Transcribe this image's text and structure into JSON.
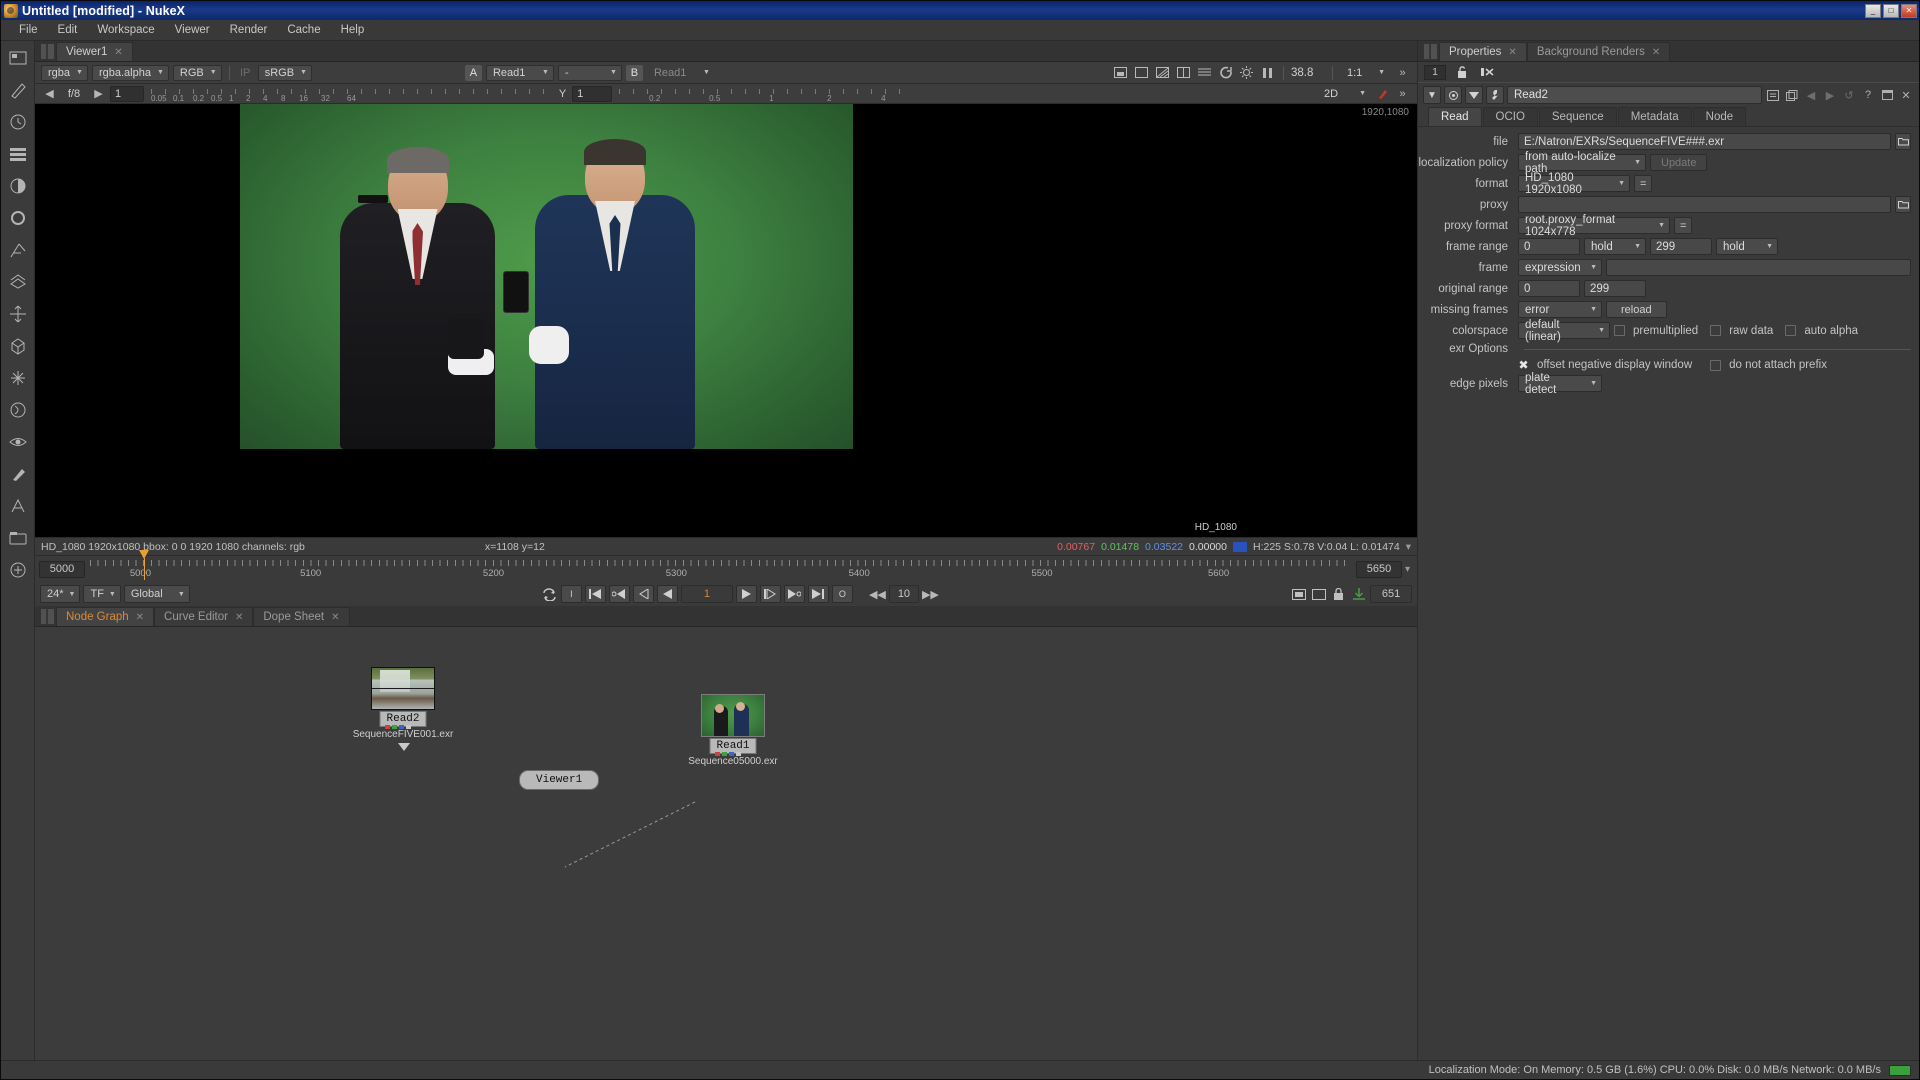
{
  "window": {
    "title": "Untitled [modified] - NukeX",
    "app_icon": "nuke-logo-icon",
    "buttons": {
      "minimize": "_",
      "maximize": "□",
      "close": "✕"
    }
  },
  "menubar": {
    "items": [
      "File",
      "Edit",
      "Workspace",
      "Viewer",
      "Render",
      "Cache",
      "Help"
    ]
  },
  "toolrail": {
    "items": [
      {
        "name": "image-node-icon"
      },
      {
        "name": "draw-node-icon"
      },
      {
        "name": "time-node-icon"
      },
      {
        "name": "channel-node-icon"
      },
      {
        "name": "color-node-icon"
      },
      {
        "name": "filter-node-icon"
      },
      {
        "name": "keyer-node-icon"
      },
      {
        "name": "merge-node-icon"
      },
      {
        "name": "transform-node-icon"
      },
      {
        "name": "3d-node-icon"
      },
      {
        "name": "particles-node-icon"
      },
      {
        "name": "deep-node-icon"
      },
      {
        "name": "views-node-icon"
      },
      {
        "name": "metadata-node-icon"
      },
      {
        "name": "toolsets-node-icon"
      },
      {
        "name": "other-node-icon"
      },
      {
        "name": "plugins-node-icon"
      }
    ]
  },
  "viewer": {
    "tab_label": "Viewer1",
    "tab_close": "✕",
    "toolbar": {
      "channels": "rgba",
      "layer": "rgba.alpha",
      "display": "RGB",
      "ip_label": "IP",
      "viewer_process": "sRGB",
      "a_label": "A",
      "a_input": "Read1",
      "mix_value": "-",
      "b_label": "B",
      "b_input": "Read1",
      "zoom_value": "38.8",
      "ratio": "1:1",
      "icons": [
        "roi-icon",
        "format-icon",
        "wipe-icon",
        "compare-icon",
        "proxy-icon",
        "refresh-icon",
        "gear-icon",
        "pause-icon"
      ]
    },
    "toolbar2": {
      "gain_label": "f/8",
      "gain_value": "1",
      "gamma_label": "Y",
      "gamma_value": "1",
      "dim_mode": "2D",
      "ruler_labels": [
        "0.05",
        "0.1",
        "0.2",
        "0.5",
        "1",
        "2",
        "4",
        "8",
        "16",
        "32",
        "64"
      ],
      "ruler_small": [
        "0.2",
        "0.5",
        "1",
        "2",
        "4"
      ]
    },
    "overlay_top_right": "1920,1080",
    "overlay_bottom_right": "HD_1080",
    "status": {
      "format_info": "HD_1080 1920x1080  bbox: 0 0 1920 1080 channels: rgb",
      "coords": "x=1108 y=12",
      "r": "0.00767",
      "g": "0.01478",
      "b": "0.03522",
      "a": "0.00000",
      "hsv": "H:225 S:0.78 V:0.04  L: 0.01474"
    }
  },
  "timeline": {
    "start_frame": "5000",
    "end_frame": "5650",
    "ticks": [
      "5000",
      "5100",
      "5200",
      "5300",
      "5400",
      "5500",
      "5600",
      "5650"
    ],
    "playhead_frame": "5000",
    "transport": {
      "loop_icon": "loop-icon",
      "buttons": [
        "set-in-icon",
        "first-frame-icon",
        "prev-keyframe-icon",
        "prev-frame-icon",
        "play-backward-icon"
      ],
      "current_frame": "1",
      "buttons_right": [
        "play-forward-icon",
        "next-frame-icon",
        "next-keyframe-icon",
        "last-frame-icon",
        "set-out-icon"
      ],
      "back_icon": "skip-back-icon",
      "increment": "10",
      "fwd_icon": "skip-forward-icon",
      "fps": "24*",
      "fps_mode": "TF",
      "sync_mode": "Global",
      "right_icons": [
        "key-icon",
        "lock-icon",
        "sync-icon",
        "download-icon"
      ],
      "right_value": "651"
    }
  },
  "nodegraph": {
    "tabs": [
      {
        "label": "Node Graph",
        "active": true,
        "close": "✕"
      },
      {
        "label": "Curve Editor",
        "active": false,
        "close": "✕"
      },
      {
        "label": "Dope Sheet",
        "active": false,
        "close": "✕"
      }
    ],
    "nodes": [
      {
        "name": "Read2",
        "file": "SequenceFIVE001.exr",
        "thumb": "waterfall"
      },
      {
        "name": "Read1",
        "file": "Sequence05000.exr",
        "thumb": "greenscreen"
      },
      {
        "name": "Viewer1",
        "type": "viewer"
      }
    ]
  },
  "properties": {
    "tabs": [
      {
        "label": "Properties",
        "active": true,
        "close": "✕"
      },
      {
        "label": "Background Renders",
        "active": false,
        "close": "✕"
      }
    ],
    "toolbar": {
      "count": "1",
      "lock_icon": "unlock-icon",
      "clear_icon": "clear-all-icon"
    },
    "node_header": {
      "collapse_icon": "triangle-down-icon",
      "color_icon": "color-swatch-icon",
      "mask_icon": "mask-icon",
      "wrench_icon": "wrench-icon",
      "node_name": "Read2",
      "icons": [
        "script-icon",
        "duplicate-icon",
        "prev-icon",
        "next-icon",
        "revert-icon",
        "help-icon",
        "float-icon",
        "close-icon"
      ]
    },
    "node_tabs": [
      {
        "label": "Read",
        "active": true
      },
      {
        "label": "OCIO",
        "active": false
      },
      {
        "label": "Sequence",
        "active": false
      },
      {
        "label": "Metadata",
        "active": false
      },
      {
        "label": "Node",
        "active": false
      }
    ],
    "fields": {
      "file": {
        "label": "file",
        "value": "E:/Natron/EXRs/SequenceFIVE###.exr",
        "browse_icon": "folder-icon"
      },
      "localization_policy": {
        "label": "localization policy",
        "value": "from auto-localize path",
        "button": "Update"
      },
      "format": {
        "label": "format",
        "value": "HD_1080 1920x1080",
        "eq_button": "="
      },
      "proxy": {
        "label": "proxy",
        "value": "",
        "browse_icon": "folder-icon"
      },
      "proxy_format": {
        "label": "proxy format",
        "value": "root.proxy_format 1024x778",
        "eq_button": "="
      },
      "frame_range": {
        "label": "frame range",
        "start": "0",
        "start_mode": "hold",
        "end": "299",
        "end_mode": "hold"
      },
      "frame": {
        "label": "frame",
        "mode": "expression",
        "value": ""
      },
      "original_range": {
        "label": "original range",
        "start": "0",
        "end": "299"
      },
      "missing_frames": {
        "label": "missing frames",
        "value": "error",
        "button": "reload"
      },
      "colorspace": {
        "label": "colorspace",
        "value": "default (linear)",
        "checks": [
          {
            "label": "premultiplied",
            "checked": false
          },
          {
            "label": "raw data",
            "checked": false
          },
          {
            "label": "auto alpha",
            "checked": false
          }
        ]
      },
      "exr_options": {
        "label": "exr Options"
      },
      "exr_checks": [
        {
          "label": "offset negative display window",
          "checked": true
        },
        {
          "label": "do not attach prefix",
          "checked": false
        }
      ],
      "edge_pixels": {
        "label": "edge pixels",
        "value": "plate detect"
      }
    }
  },
  "statusbar": {
    "text": "Localization Mode: On  Memory: 0.5 GB (1.6%)  CPU: 0.0%  Disk: 0.0 MB/s  Network: 0.0 MB/s",
    "indicator": "memory-bar-icon"
  },
  "colors": {
    "accent_orange": "#d98b3a",
    "title_blue": "#0a246a",
    "panel_bg": "#3a3a3a",
    "green_screen": "#3d8040"
  }
}
